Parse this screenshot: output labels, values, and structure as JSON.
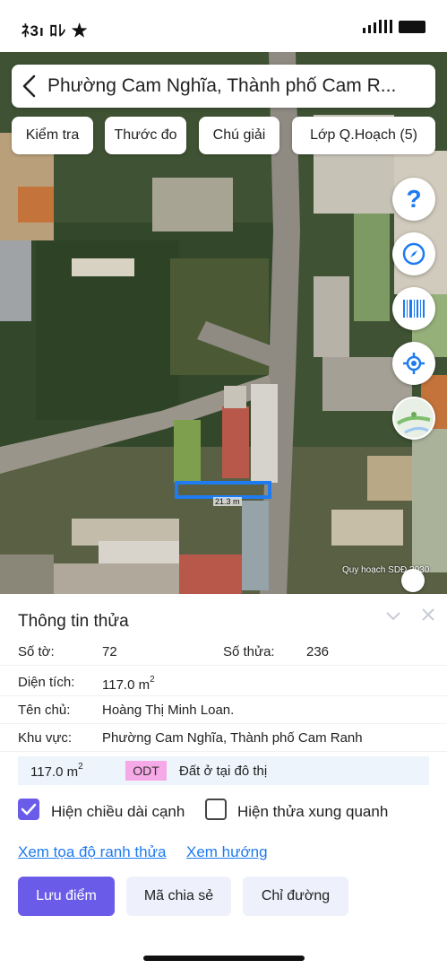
{
  "status_bar": {
    "left_text": "ﾈ3ı ﾛﾚ ★"
  },
  "search": {
    "title": "Phường Cam Nghĩa, Thành phố Cam R..."
  },
  "toolbar": {
    "check_label": "Kiểm tra",
    "ruler_label": "Thước đo",
    "legend_label": "Chú giải",
    "layer_label": "Lớp Q.Hoạch (5)"
  },
  "map": {
    "measure_label": "21.3 m",
    "credit": "Quy hoạch SDĐ 2030",
    "help_glyph": "?"
  },
  "panel": {
    "title": "Thông tin thửa",
    "so_to_label": "Số tờ:",
    "so_to_value": "72",
    "so_thua_label": "Số thửa:",
    "so_thua_value": "236",
    "dien_tich_label": "Diện tích:",
    "dien_tich_value": "117.0 m",
    "dien_tich_sup": "2",
    "ten_chu_label": "Tên chủ:",
    "ten_chu_value": "Hoàng Thị Minh Loan.",
    "khu_vuc_label": "Khu vực:",
    "khu_vuc_value": "Phường Cam Nghĩa, Thành phố Cam Ranh",
    "zone_area": "117.0 m",
    "zone_area_sup": "2",
    "zone_code": "ODT",
    "zone_desc": "Đất ở tại đô thị",
    "chk_edges_label": "Hiện chiều dài cạnh",
    "chk_edges_checked": true,
    "chk_neighbors_label": "Hiện thửa xung quanh",
    "chk_neighbors_checked": false,
    "link_coords": "Xem tọa độ ranh thửa",
    "link_direction": "Xem hướng",
    "btn_save": "Lưu điểm",
    "btn_share": "Mã chia sẻ",
    "btn_route": "Chỉ đường"
  },
  "colors": {
    "accent": "#1e7bf0",
    "primary_button": "#6a5ce8",
    "secondary_button": "#eef0fb",
    "odt_badge": "#f5a9e6",
    "zone_row_bg": "#eef4fb"
  }
}
